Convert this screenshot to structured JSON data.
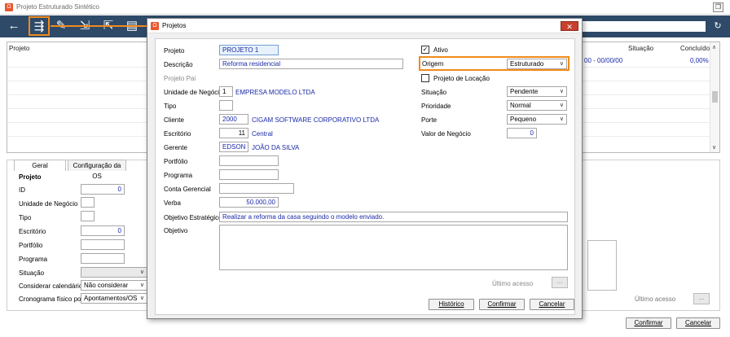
{
  "main_window": {
    "title": "Projeto Estruturado Sintético",
    "restore_label": "❐",
    "grid_headers": {
      "projeto": "Projeto",
      "situacao": "Situação",
      "concluido": "Concluído"
    },
    "grid_row": {
      "dates": "00  -  00/00/00",
      "concluido": "0,00%"
    },
    "tabs": [
      "Geral",
      "Configuração da OS"
    ],
    "section_title": "Projeto",
    "fields": {
      "id_label": "ID",
      "id_value": "0",
      "unidade_label": "Unidade de Negócio",
      "tipo_label": "Tipo",
      "escritorio_label": "Escritório",
      "escritorio_value": "0",
      "portfolio_label": "Portfólio",
      "programa_label": "Programa",
      "situacao_label": "Situação",
      "calendario_label": "Considerar calendário",
      "calendario_value": "Não considerar",
      "cronograma_label": "Cronograma físico por",
      "cronograma_value": "Apontamentos/OS"
    },
    "ultimo_acesso_label": "Último acesso",
    "dots_label": "...",
    "confirm_label": "Confirmar",
    "cancel_label": "Cancelar"
  },
  "dialog": {
    "title": "Projetos",
    "close_label": "✕",
    "projeto_label": "Projeto",
    "projeto_value": "PROJETO 1",
    "descricao_label": "Descrição",
    "descricao_value": "Reforma residencial",
    "projeto_pai_label": "Projeto Pai",
    "unidade_label": "Unidade de Negócio",
    "unidade_code": "1",
    "unidade_name": "EMPRESA MODELO LTDA",
    "tipo_label": "Tipo",
    "cliente_label": "Cliente",
    "cliente_code": "2000",
    "cliente_name": "CIGAM SOFTWARE CORPORATIVO LTDA",
    "escritorio_label": "Escritório",
    "escritorio_code": "11",
    "escritorio_name": "Central",
    "gerente_label": "Gerente",
    "gerente_code": "EDSON",
    "gerente_name": "JOÃO DA SILVA",
    "portfolio_label": "Portfólio",
    "programa_label": "Programa",
    "conta_label": "Conta Gerencial",
    "verba_label": "Verba",
    "verba_value": "50.000,00",
    "objetivo_estrategico_label": "Objetivo Estratégico",
    "objetivo_estrategico_value": "Realizar a reforma da casa seguindo o modelo enviado.",
    "objetivo_label": "Objetivo",
    "ativo_label": "Ativo",
    "origem_label": "Origem",
    "origem_value": "Estruturado",
    "locacao_label": "Projeto de Locação",
    "situacao_label": "Situação",
    "situacao_value": "Pendente",
    "prioridade_label": "Prioridade",
    "prioridade_value": "Normal",
    "porte_label": "Porte",
    "porte_value": "Pequeno",
    "valor_label": "Valor de Negócio",
    "valor_value": "0",
    "ultimo_acesso_label": "Último acesso",
    "dots_label": "...",
    "historico_label": "Histórico",
    "confirmar_label": "Confirmar",
    "cancelar_label": "Cancelar"
  },
  "toolbar": {
    "back_icon": "←",
    "structure_icon": "⇶",
    "edit_icon": "✎",
    "export_icon": "⇲",
    "import_icon": "⇱",
    "clipboard_icon": "▤",
    "refresh_icon": "↻"
  },
  "colors": {
    "toolbar": "#2e4a68",
    "highlight": "#f08a1c",
    "value_text": "#1a2aa6"
  }
}
